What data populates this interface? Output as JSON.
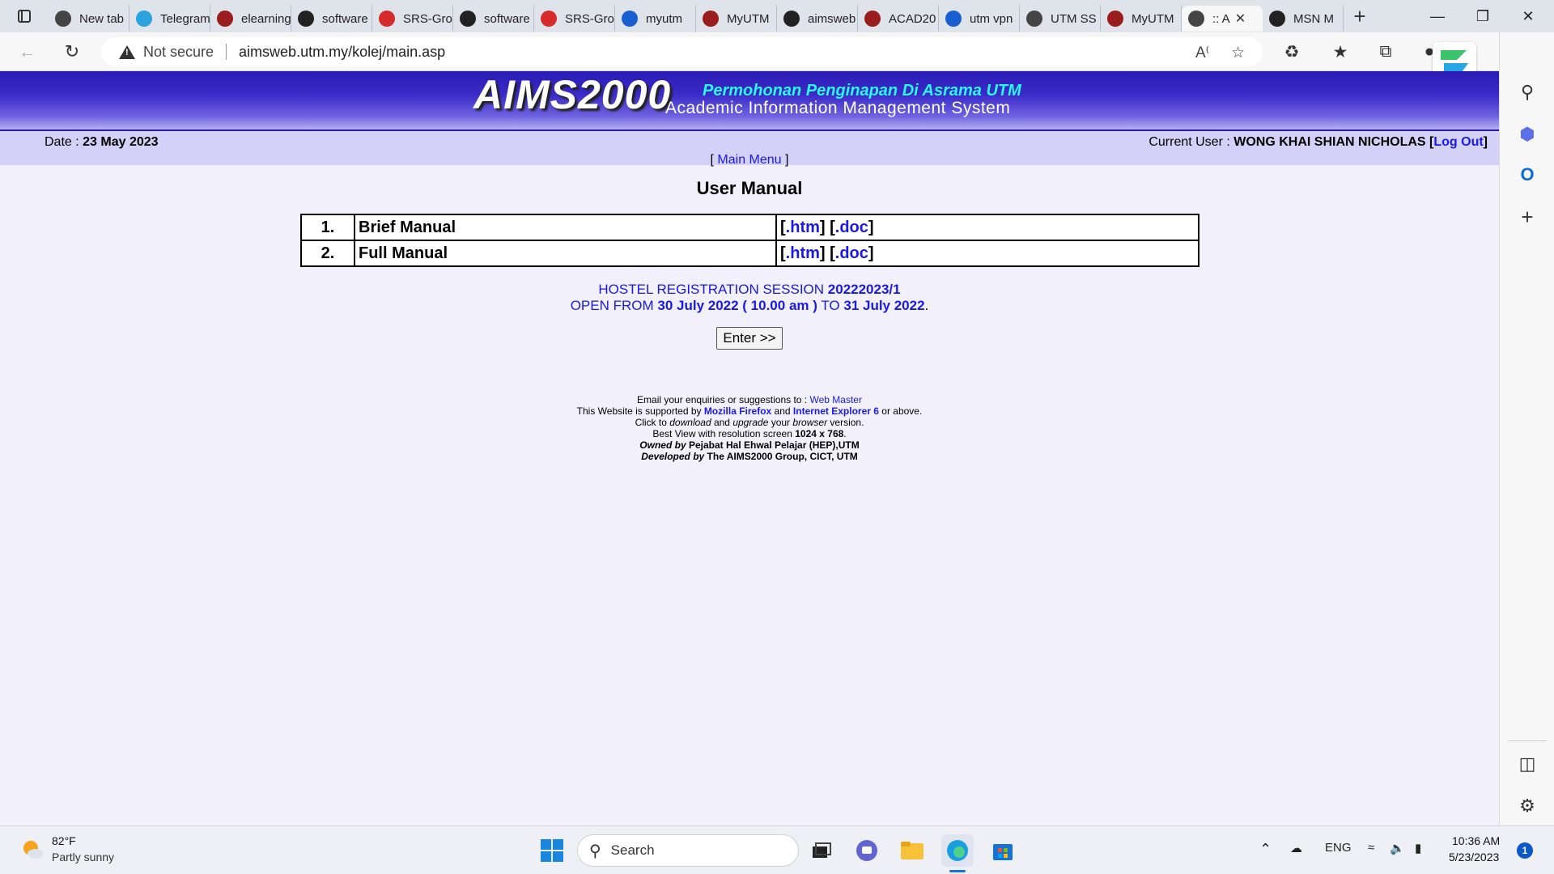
{
  "browser": {
    "tabs": [
      {
        "label": "New tab",
        "icon": "new-tab-icon",
        "color": "#444444"
      },
      {
        "label": "Telegram",
        "icon": "telegram-icon",
        "color": "#2aa3df"
      },
      {
        "label": "elearning",
        "icon": "utm-icon",
        "color": "#9b1c1c"
      },
      {
        "label": "software",
        "icon": "github-icon",
        "color": "#222222"
      },
      {
        "label": "SRS-Gro",
        "icon": "pdf-icon",
        "color": "#d62b2b"
      },
      {
        "label": "software",
        "icon": "github-icon",
        "color": "#222222"
      },
      {
        "label": "SRS-Gro",
        "icon": "pdf-icon",
        "color": "#d62b2b"
      },
      {
        "label": "myutm",
        "icon": "search-icon",
        "color": "#1a5fd1"
      },
      {
        "label": "MyUTM",
        "icon": "utm-icon",
        "color": "#9b1c1c"
      },
      {
        "label": "aimsweb",
        "icon": "document-icon",
        "color": "#222222"
      },
      {
        "label": "ACAD20",
        "icon": "utm-icon",
        "color": "#9b1c1c"
      },
      {
        "label": "utm vpn",
        "icon": "search-icon",
        "color": "#1a5fd1"
      },
      {
        "label": "UTM SS",
        "icon": "document-icon",
        "color": "#444444"
      },
      {
        "label": "MyUTM",
        "icon": "utm-icon",
        "color": "#9b1c1c"
      },
      {
        "label": ":: A",
        "icon": "document-icon",
        "color": "#444444",
        "active": true
      },
      {
        "label": "MSN M",
        "icon": "msn-icon",
        "color": "#222222"
      }
    ],
    "new_tab": "+",
    "address": {
      "security": "Not secure",
      "url": "aimsweb.utm.my/kolej/main.asp"
    }
  },
  "page": {
    "banner": {
      "logo": "AIMS2000",
      "subtitle": "Permohonan Penginapan Di Asrama UTM",
      "tagline": "Academic Information Management System"
    },
    "date_label": "Date : ",
    "date_value": "23 May 2023",
    "user_label": "Current User : ",
    "user_name": "WONG KHAI SHIAN NICHOLAS",
    "logout": "Log Out",
    "main_menu": "Main Menu",
    "title": "User Manual",
    "manuals": [
      {
        "num": "1.",
        "name": "Brief Manual",
        "htm": ".htm",
        "doc": ".doc"
      },
      {
        "num": "2.",
        "name": "Full Manual",
        "htm": ".htm",
        "doc": ".doc"
      }
    ],
    "session": {
      "label": "HOSTEL REGISTRATION SESSION ",
      "code": "20222023/1",
      "open_label": "OPEN FROM ",
      "open_from": "30 July 2022 ( 10.00 am )",
      "to_label": " TO ",
      "open_to": "31 July 2022",
      "period": "."
    },
    "enter_button": "Enter >>",
    "footer": {
      "email_text": "Email your enquiries or suggestions to : ",
      "webmaster": "Web Master",
      "supported_text": "This Website is supported by ",
      "firefox": "Mozilla Firefox",
      "and": " and ",
      "ie": "Internet Explorer 6",
      "or_above": " or above.",
      "click": "Click to ",
      "download": "download",
      "and2": " and ",
      "upgrade": "upgrade",
      "your": " your ",
      "browser": "browser",
      "version": " version.",
      "bestview": "Best View with resolution screen ",
      "resolution": "1024 x 768",
      "dot": ".",
      "owned_label": "Owned by ",
      "owned": "Pejabat Hal Ehwal Pelajar (HEP),UTM",
      "dev_label": "Developed by ",
      "dev": "The AIMS2000 Group, CICT, UTM"
    }
  },
  "taskbar": {
    "weather_temp": "82°F",
    "weather_desc": "Partly sunny",
    "search": "Search",
    "lang": "ENG",
    "time": "10:36 AM",
    "date": "5/23/2023",
    "notifications": "1"
  }
}
